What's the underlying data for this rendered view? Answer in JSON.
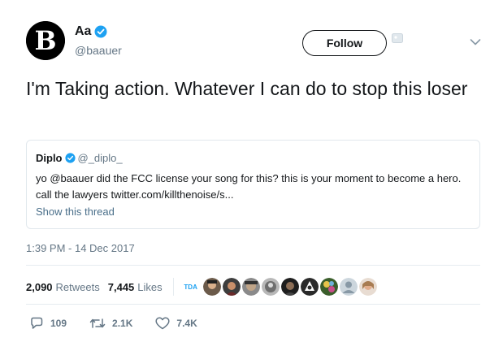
{
  "tweet": {
    "author": {
      "display_name": "Aa",
      "handle": "@baauer",
      "avatar_letter": "B"
    },
    "follow_label": "Follow",
    "text": "I'm Taking action. Whatever I can do to stop this loser",
    "quoted": {
      "display_name": "Diplo",
      "handle": "@_diplo_",
      "text": "yo @baauer did the FCC license your  song for this? this is your moment to become a hero. call the lawyers twitter.com/killthenoise/s...",
      "thread_link": "Show this thread"
    },
    "timestamp": "1:39 PM - 14 Dec 2017",
    "stats": {
      "retweets_count": "2,090",
      "retweets_label": "Retweets",
      "likes_count": "7,445",
      "likes_label": "Likes",
      "first_liker_label": "TDA"
    },
    "actions": {
      "replies": "109",
      "retweets": "2.1K",
      "likes": "7.4K"
    }
  },
  "colors": {
    "verified": "#1da1f2",
    "text_primary": "#14171a",
    "text_secondary": "#657786",
    "border": "#e1e8ed"
  },
  "icons": [
    "verified-badge-icon",
    "chevron-down-icon",
    "reply-icon",
    "retweet-icon",
    "heart-icon"
  ]
}
